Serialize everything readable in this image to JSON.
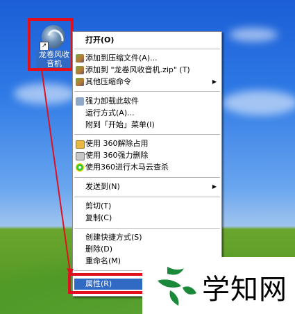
{
  "desktop": {
    "icon": {
      "label": "龙卷风收音机",
      "shortcut_glyph": "↗"
    }
  },
  "context_menu": {
    "items": [
      {
        "label": "打开(O)",
        "bold": true
      },
      {
        "label": "添加到压缩文件(A)..."
      },
      {
        "label": "添加到 \"龙卷风收音机.zip\" (T)"
      },
      {
        "label": "其他压缩命令"
      },
      {
        "label": "强力卸载此软件"
      },
      {
        "label": "运行方式(A)..."
      },
      {
        "label": "附到「开始」菜单(I)"
      },
      {
        "label": "使用 360解除占用"
      },
      {
        "label": "使用 360强力删除"
      },
      {
        "label": "使用360进行木马云查杀"
      },
      {
        "label": "发送到(N)"
      },
      {
        "label": "剪切(T)"
      },
      {
        "label": "复制(C)"
      },
      {
        "label": "创建快捷方式(S)"
      },
      {
        "label": "删除(D)"
      },
      {
        "label": "重命名(M)"
      },
      {
        "label": "属性(R)"
      }
    ],
    "submenu_arrow": "▶"
  },
  "annotation": {
    "color": "#e0101e"
  },
  "watermark": {
    "text": "学知网"
  }
}
